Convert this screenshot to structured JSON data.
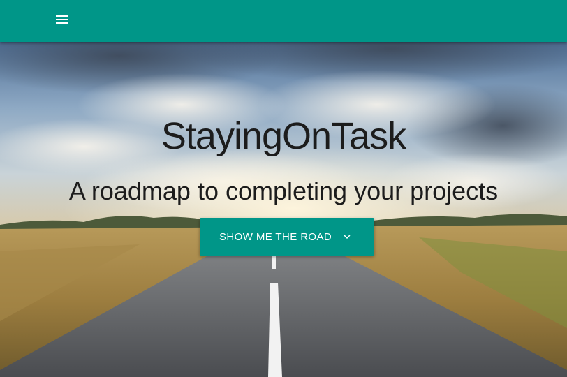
{
  "appbar": {
    "menu_icon": "hamburger-menu-icon",
    "color": "#009688"
  },
  "hero": {
    "title": "StayingOnTask",
    "subtitle": "A roadmap to completing your projects",
    "cta_label": "SHOW ME THE ROAD",
    "cta_icon": "chevron-down-icon",
    "cta_color": "#009688"
  }
}
